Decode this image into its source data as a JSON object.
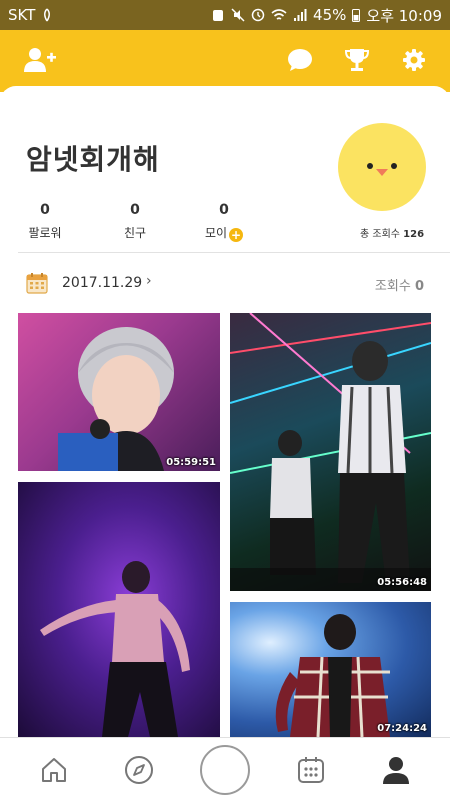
{
  "status_bar": {
    "carrier": "SKT",
    "battery": "45%",
    "time": "오후 10:09"
  },
  "top_bar": {
    "icons": [
      "add-friend-icon",
      "chat-icon",
      "trophy-icon",
      "gear-icon"
    ],
    "color": "#f8c21c"
  },
  "profile": {
    "name": "암넷회개해",
    "stats": [
      {
        "value": "0",
        "label": "팔로워"
      },
      {
        "value": "0",
        "label": "친구"
      },
      {
        "value": "0",
        "label": "모이"
      }
    ],
    "total_views_label": "총 조회수",
    "total_views": "126"
  },
  "feed": {
    "date": "2017.11.29",
    "views_label": "조회수",
    "views": "0",
    "photos": [
      {
        "time": "05:59:51"
      },
      {
        "time": "05:56:48"
      },
      {
        "time": ""
      },
      {
        "time": "07:24:24"
      }
    ]
  },
  "bottom_nav": {
    "items": [
      "home-icon",
      "compass-icon",
      "record-button",
      "calendar-icon",
      "profile-icon"
    ]
  }
}
